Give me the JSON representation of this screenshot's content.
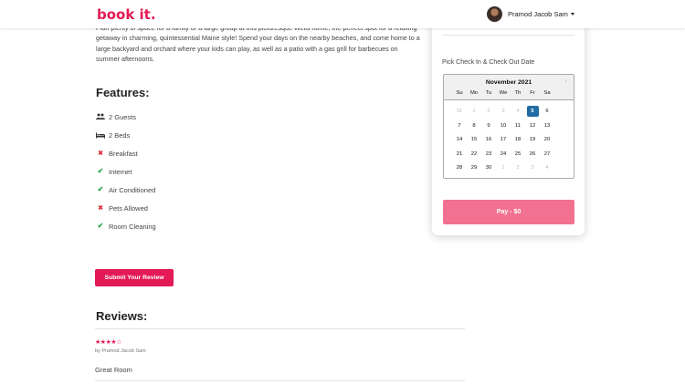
{
  "header": {
    "logo": "book it.",
    "user_name": "Pramod Jacob Sam"
  },
  "room": {
    "description": "Plan plenty of space for a family or a large group at this picturesque Wells home, the perfect spot for a relaxing getaway in charming, quintessential Maine style! Spend your days on the nearby beaches, and come home to a large backyard and orchard where your kids can play, as well as a patio with a gas grill for barbecues on summer afternoons.",
    "features_title": "Features:",
    "features": [
      {
        "label": "2 Guests",
        "icon": "users-icon",
        "status": "info"
      },
      {
        "label": "2 Beds",
        "icon": "bed-icon",
        "status": "info"
      },
      {
        "label": "Breakfast",
        "icon": "cross-icon",
        "status": "no"
      },
      {
        "label": "Internet",
        "icon": "check-icon",
        "status": "yes"
      },
      {
        "label": "Air Conditioned",
        "icon": "check-icon",
        "status": "yes"
      },
      {
        "label": "Pets Allowed",
        "icon": "cross-icon",
        "status": "no"
      },
      {
        "label": "Room Cleaning",
        "icon": "check-icon",
        "status": "yes"
      }
    ],
    "submit_review_label": "Submit Your Review"
  },
  "reviews": {
    "title": "Reviews:",
    "items": [
      {
        "rating": 4,
        "max_rating": 5,
        "by": "by Pramod Jacob Sam",
        "comment": "Great Room"
      }
    ]
  },
  "booking": {
    "pick_label": "Pick Check In & Check Out Date",
    "calendar": {
      "month": "November 2021",
      "weekdays": [
        "Su",
        "Mo",
        "Tu",
        "We",
        "Th",
        "Fr",
        "Sa"
      ],
      "weeks": [
        [
          "31",
          "1",
          "2",
          "3",
          "4",
          "5",
          "6"
        ],
        [
          "7",
          "8",
          "9",
          "10",
          "11",
          "12",
          "13"
        ],
        [
          "14",
          "15",
          "16",
          "17",
          "18",
          "19",
          "20"
        ],
        [
          "21",
          "22",
          "23",
          "24",
          "25",
          "26",
          "27"
        ],
        [
          "28",
          "29",
          "30",
          "1",
          "2",
          "3",
          "4"
        ]
      ],
      "selected_day": "5"
    },
    "pay_label": "Pay - $0"
  },
  "colors": {
    "brand": "#e31a55",
    "pay": "#f27190",
    "check": "#28a745",
    "cross": "#dc3545",
    "selected": "#216ba5"
  }
}
